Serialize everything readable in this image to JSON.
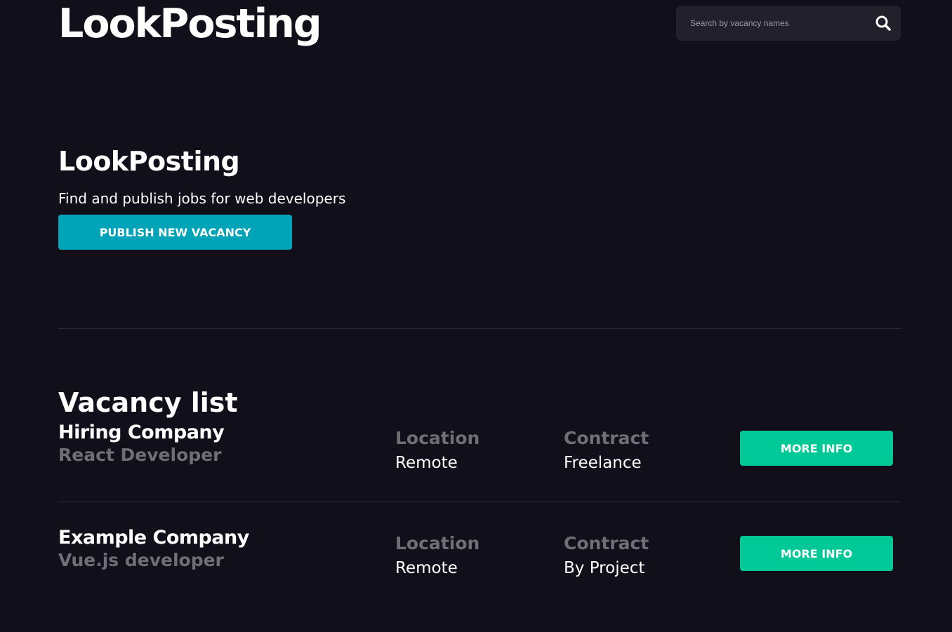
{
  "header": {
    "logo": "LookPosting",
    "search": {
      "placeholder": "Search by vacancy names",
      "value": "",
      "icon": "search-icon"
    }
  },
  "hero": {
    "title": "LookPosting",
    "subtitle": "Find and publish jobs for web developers",
    "publish_label": "PUBLISH NEW VACANCY"
  },
  "vacancy_list": {
    "title": "Vacancy list",
    "location_label": "Location",
    "contract_label": "Contract",
    "more_info_label": "MORE INFO",
    "items": [
      {
        "company": "Hiring Company",
        "position": "React Developer",
        "location": "Remote",
        "contract": "Freelance"
      },
      {
        "company": "Example Company",
        "position": "Vue.js developer",
        "location": "Remote",
        "contract": "By Project"
      }
    ]
  },
  "colors": {
    "background": "#11101a",
    "search_background": "#22212b",
    "publish_button": "#00a4b9",
    "more_info_button": "#00c896",
    "muted_text": "#6f6e74",
    "divider": "#2b2a33"
  }
}
